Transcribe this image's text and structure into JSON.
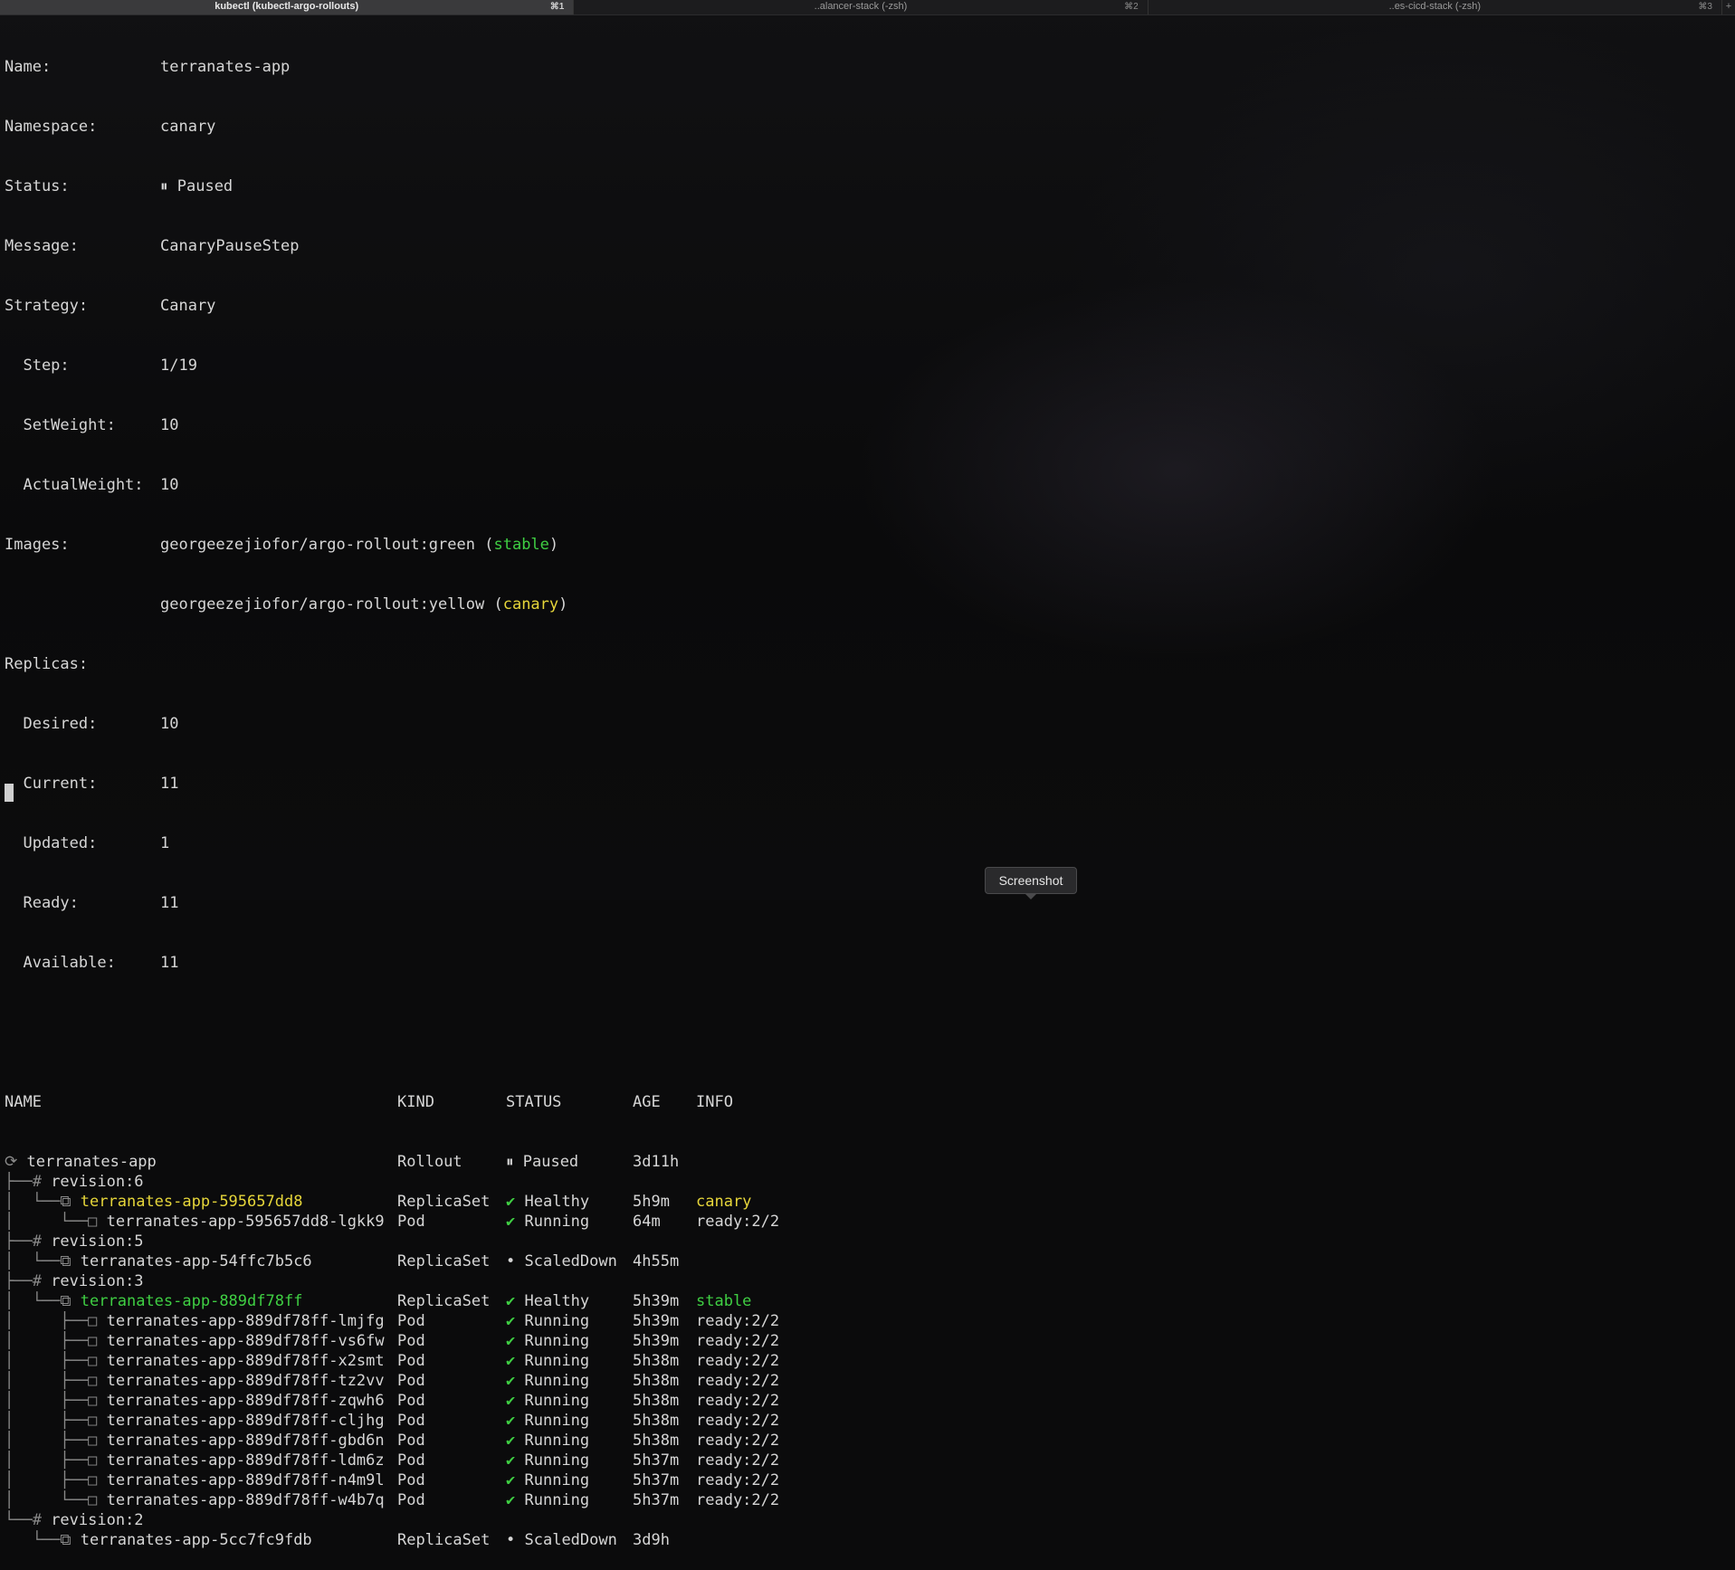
{
  "tabs": [
    {
      "label": "kubectl (kubectl-argo-rollouts)",
      "shortcut": "⌘1"
    },
    {
      "label": "..alancer-stack (-zsh)",
      "shortcut": "⌘2"
    },
    {
      "label": "..es-cicd-stack (-zsh)",
      "shortcut": "⌘3"
    }
  ],
  "tab_plus": "+",
  "header": {
    "name": {
      "label": "Name:",
      "value": "terranates-app"
    },
    "namespace": {
      "label": "Namespace:",
      "value": "canary"
    },
    "status": {
      "label": "Status:",
      "icon": "⏸",
      "value": "Paused"
    },
    "message": {
      "label": "Message:",
      "value": "CanaryPauseStep"
    },
    "strategy": {
      "label": "Strategy:",
      "value": "Canary"
    },
    "step": {
      "label": "  Step:",
      "value": "1/19"
    },
    "setweight": {
      "label": "  SetWeight:",
      "value": "10"
    },
    "actualweight": {
      "label": "  ActualWeight:",
      "value": "10"
    },
    "images": {
      "label": "Images:",
      "list": [
        {
          "image": "georgeezejiofor/argo-rollout:green",
          "tag": "stable"
        },
        {
          "image": "georgeezejiofor/argo-rollout:yellow",
          "tag": "canary"
        }
      ]
    },
    "replicas": {
      "label": "Replicas:",
      "desired": {
        "label": "  Desired:",
        "value": "10"
      },
      "current": {
        "label": "  Current:",
        "value": "11"
      },
      "updated": {
        "label": "  Updated:",
        "value": "1"
      },
      "ready": {
        "label": "  Ready:",
        "value": "11"
      },
      "available": {
        "label": "  Available:",
        "value": "11"
      }
    }
  },
  "table": {
    "columns": [
      "NAME",
      "KIND",
      "STATUS",
      "AGE",
      "INFO"
    ],
    "rows": [
      {
        "prefix": "⟳ ",
        "name": "terranates-app",
        "kind": "Rollout",
        "status_icon": "⏸",
        "status": "Paused",
        "age": "3d11h",
        "info": ""
      },
      {
        "prefix": "├──# ",
        "name": "revision:6",
        "kind": "",
        "status_icon": "",
        "status": "",
        "age": "",
        "info": ""
      },
      {
        "prefix": "│  └──⧉ ",
        "name": "terranates-app-595657dd8",
        "kind": "ReplicaSet",
        "status_icon": "✔",
        "status": "Healthy",
        "age": "5h9m",
        "info": "canary"
      },
      {
        "prefix": "│     └──□ ",
        "name": "terranates-app-595657dd8-lgkk9",
        "kind": "Pod",
        "status_icon": "✔",
        "status": "Running",
        "age": "64m",
        "info": "ready:2/2"
      },
      {
        "prefix": "├──# ",
        "name": "revision:5",
        "kind": "",
        "status_icon": "",
        "status": "",
        "age": "",
        "info": ""
      },
      {
        "prefix": "│  └──⧉ ",
        "name": "terranates-app-54ffc7b5c6",
        "kind": "ReplicaSet",
        "status_icon": "•",
        "status": "ScaledDown",
        "age": "4h55m",
        "info": ""
      },
      {
        "prefix": "├──# ",
        "name": "revision:3",
        "kind": "",
        "status_icon": "",
        "status": "",
        "age": "",
        "info": ""
      },
      {
        "prefix": "│  └──⧉ ",
        "name": "terranates-app-889df78ff",
        "kind": "ReplicaSet",
        "status_icon": "✔",
        "status": "Healthy",
        "age": "5h39m",
        "info": "stable"
      },
      {
        "prefix": "│     ├──□ ",
        "name": "terranates-app-889df78ff-lmjfg",
        "kind": "Pod",
        "status_icon": "✔",
        "status": "Running",
        "age": "5h39m",
        "info": "ready:2/2"
      },
      {
        "prefix": "│     ├──□ ",
        "name": "terranates-app-889df78ff-vs6fw",
        "kind": "Pod",
        "status_icon": "✔",
        "status": "Running",
        "age": "5h39m",
        "info": "ready:2/2"
      },
      {
        "prefix": "│     ├──□ ",
        "name": "terranates-app-889df78ff-x2smt",
        "kind": "Pod",
        "status_icon": "✔",
        "status": "Running",
        "age": "5h38m",
        "info": "ready:2/2"
      },
      {
        "prefix": "│     ├──□ ",
        "name": "terranates-app-889df78ff-tz2vv",
        "kind": "Pod",
        "status_icon": "✔",
        "status": "Running",
        "age": "5h38m",
        "info": "ready:2/2"
      },
      {
        "prefix": "│     ├──□ ",
        "name": "terranates-app-889df78ff-zqwh6",
        "kind": "Pod",
        "status_icon": "✔",
        "status": "Running",
        "age": "5h38m",
        "info": "ready:2/2"
      },
      {
        "prefix": "│     ├──□ ",
        "name": "terranates-app-889df78ff-cljhg",
        "kind": "Pod",
        "status_icon": "✔",
        "status": "Running",
        "age": "5h38m",
        "info": "ready:2/2"
      },
      {
        "prefix": "│     ├──□ ",
        "name": "terranates-app-889df78ff-gbd6n",
        "kind": "Pod",
        "status_icon": "✔",
        "status": "Running",
        "age": "5h38m",
        "info": "ready:2/2"
      },
      {
        "prefix": "│     ├──□ ",
        "name": "terranates-app-889df78ff-ldm6z",
        "kind": "Pod",
        "status_icon": "✔",
        "status": "Running",
        "age": "5h37m",
        "info": "ready:2/2"
      },
      {
        "prefix": "│     ├──□ ",
        "name": "terranates-app-889df78ff-n4m9l",
        "kind": "Pod",
        "status_icon": "✔",
        "status": "Running",
        "age": "5h37m",
        "info": "ready:2/2"
      },
      {
        "prefix": "│     └──□ ",
        "name": "terranates-app-889df78ff-w4b7q",
        "kind": "Pod",
        "status_icon": "✔",
        "status": "Running",
        "age": "5h37m",
        "info": "ready:2/2"
      },
      {
        "prefix": "└──# ",
        "name": "revision:2",
        "kind": "",
        "status_icon": "",
        "status": "",
        "age": "",
        "info": ""
      },
      {
        "prefix": "   └──⧉ ",
        "name": "terranates-app-5cc7fc9fdb",
        "kind": "ReplicaSet",
        "status_icon": "•",
        "status": "ScaledDown",
        "age": "3d9h",
        "info": ""
      }
    ]
  },
  "tooltip": "Screenshot",
  "colors": {
    "canary": "#e6d63a",
    "stable": "#3fcf43",
    "ok": "#3fcf43",
    "text": "#d6d6d6"
  }
}
